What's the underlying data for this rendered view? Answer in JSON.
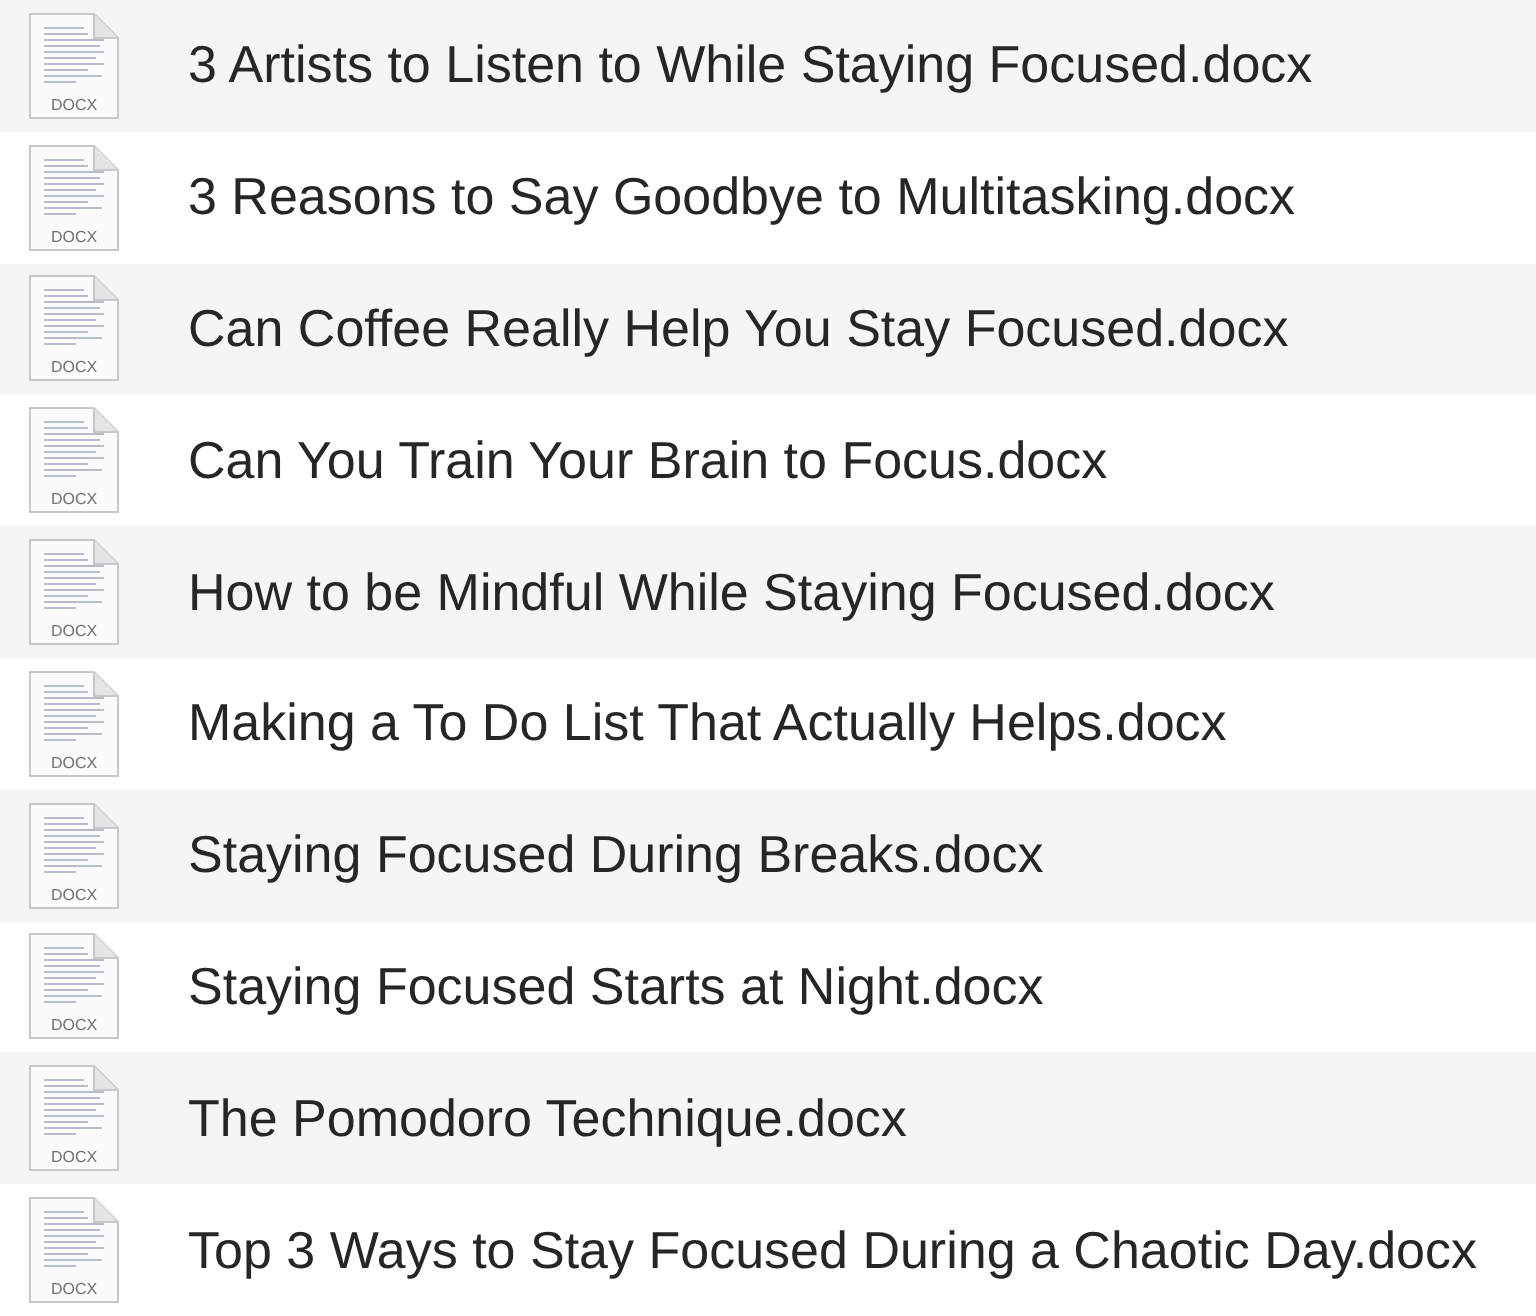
{
  "files": [
    {
      "name": "3 Artists to Listen to While Staying Focused.docx",
      "icon_label": "DOCX"
    },
    {
      "name": "3 Reasons to Say Goodbye to Multitasking.docx",
      "icon_label": "DOCX"
    },
    {
      "name": "Can Coffee Really Help You Stay Focused.docx",
      "icon_label": "DOCX"
    },
    {
      "name": "Can You Train Your Brain to Focus.docx",
      "icon_label": "DOCX"
    },
    {
      "name": "How to be Mindful While Staying Focused.docx",
      "icon_label": "DOCX"
    },
    {
      "name": "Making a To Do List That Actually Helps.docx",
      "icon_label": "DOCX"
    },
    {
      "name": "Staying Focused During Breaks.docx",
      "icon_label": "DOCX"
    },
    {
      "name": "Staying Focused Starts at Night.docx",
      "icon_label": "DOCX"
    },
    {
      "name": "The Pomodoro Technique.docx",
      "icon_label": "DOCX"
    },
    {
      "name": "Top 3 Ways to Stay Focused During a Chaotic Day.docx",
      "icon_label": "DOCX"
    }
  ]
}
